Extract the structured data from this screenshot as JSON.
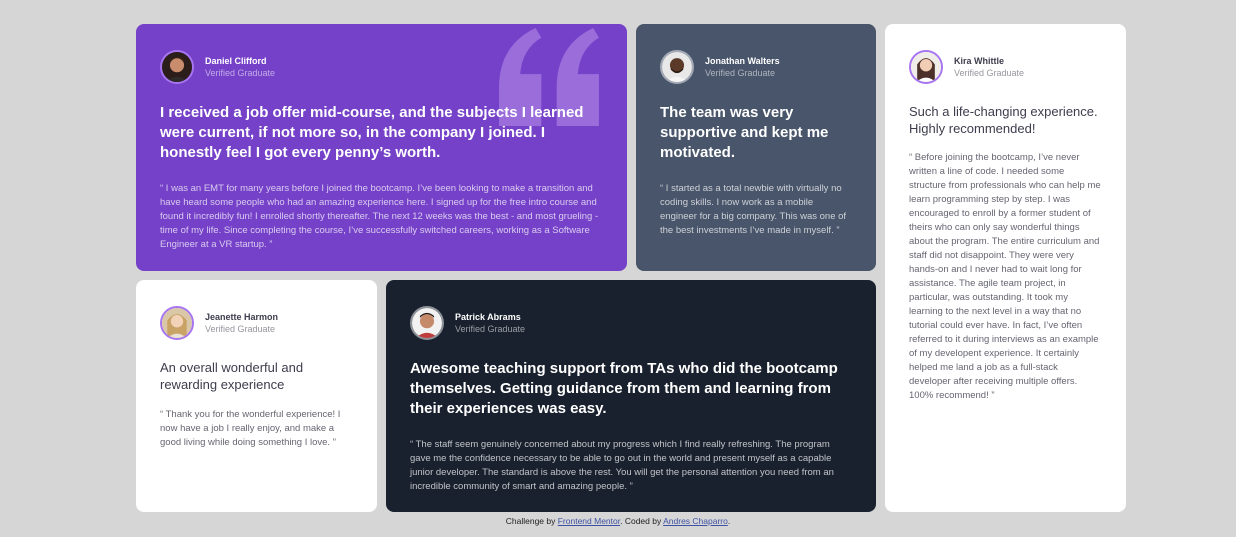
{
  "testimonials": {
    "daniel": {
      "name": "Daniel Clifford",
      "status": "Verified Graduate",
      "headline": "I received a job offer mid-course, and the subjects I learned were current, if not more so, in the company I joined. I honestly feel I got every penny’s worth.",
      "body": "“ I was an EMT for many years before I joined the bootcamp. I’ve been looking to make a transition and have heard some people who had an amazing experience here. I signed up for the free intro course and found it incredibly fun! I enrolled shortly thereafter. The next 12 weeks was the best - and most grueling - time of my life. Since completing the course, I’ve successfully switched careers, working as a Software Engineer at a VR startup. ”"
    },
    "jonathan": {
      "name": "Jonathan Walters",
      "status": "Verified Graduate",
      "headline": "The team was very supportive and kept me motivated.",
      "body": "“ I started as a total newbie with virtually no coding skills. I now work as a mobile engineer for a big company. This was one of the best investments I’ve made in myself. ”"
    },
    "kira": {
      "name": "Kira Whittle",
      "status": "Verified Graduate",
      "headline": "Such a life-changing experience. Highly recommended!",
      "body": "“ Before joining the bootcamp, I’ve never written a line of code. I needed some structure from professionals who can help me learn programming step by step. I was encouraged to enroll by a former student of theirs who can only say wonderful things about the program. The entire curriculum and staff did not disappoint. They were very hands-on and I never had to wait long for assistance. The agile team project, in particular, was outstanding. It took my learning to the next level in a way that no tutorial could ever have. In fact, I’ve often referred to it during interviews as an example of my developent experience. It certainly helped me land a job as a full-stack developer after receiving multiple offers. 100% recommend! ”"
    },
    "jeanette": {
      "name": "Jeanette Harmon",
      "status": "Verified Graduate",
      "headline": "An overall wonderful and rewarding experience",
      "body": "“ Thank you for the wonderful experience! I now have a job I really enjoy, and make a good living while doing something I love. ”"
    },
    "patrick": {
      "name": "Patrick Abrams",
      "status": "Verified Graduate",
      "headline": "Awesome teaching support from TAs who did the bootcamp themselves. Getting guidance from them and learning from their experiences was easy.",
      "body": "“ The staff seem genuinely concerned about my progress which I find really refreshing. The program gave me the confidence necessary to be able to go out in the world and present myself as a capable junior developer. The standard is above the rest. You will get the personal attention you need from an incredible community of smart and amazing people. ”"
    }
  },
  "attribution": {
    "prefix": "Challenge by ",
    "link1": "Frontend Mentor",
    "middle": ". Coded by ",
    "link2": "Andres Chaparro",
    "suffix": "."
  },
  "colors": {
    "purple": "#7541c8",
    "grayish_blue": "#48556a",
    "dark_blackish_blue": "#19212e",
    "white": "#ffffff",
    "background": "#d6d6d6"
  }
}
